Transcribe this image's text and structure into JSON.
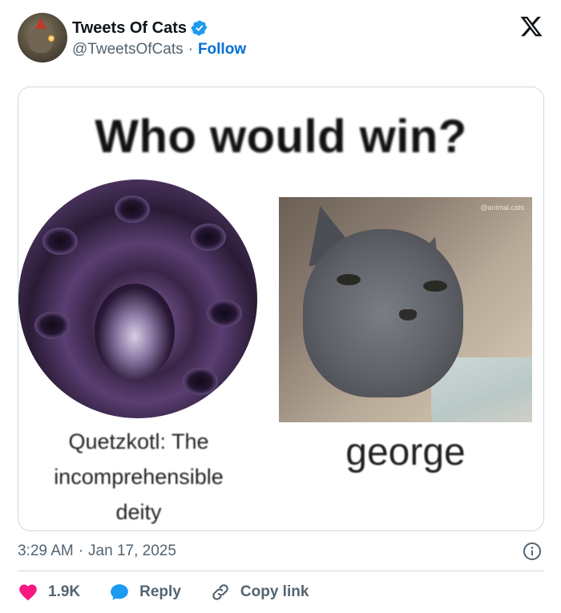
{
  "account": {
    "name": "Tweets Of Cats",
    "handle": "@TweetsOfCats",
    "separator": "·",
    "follow_label": "Follow"
  },
  "media": {
    "title": "Who would win?",
    "left_caption": "Quetzkotl: The\nincomprehensible\ndeity",
    "right_caption": "george",
    "watermark": "@animal.cats"
  },
  "meta": {
    "time": "3:29 AM",
    "separator": "·",
    "date": "Jan 17, 2025"
  },
  "actions": {
    "like_count": "1.9K",
    "reply_label": "Reply",
    "copy_label": "Copy link"
  },
  "colors": {
    "link": "#006fd6",
    "like": "#f91880",
    "reply": "#1d9bf0",
    "muted": "#536471",
    "verified": "#1d9bf0"
  },
  "icons": [
    "verified-badge-icon",
    "x-logo-icon",
    "info-icon",
    "heart-icon",
    "reply-bubble-icon",
    "link-icon"
  ]
}
